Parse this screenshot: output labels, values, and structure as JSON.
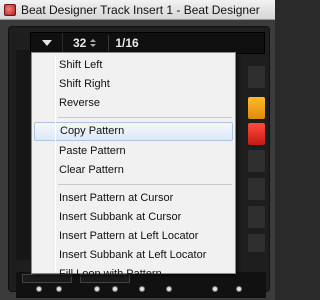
{
  "window": {
    "title": "Beat Designer Track Insert 1 - Beat Designer"
  },
  "toolbar": {
    "pattern_number": "32",
    "step_resolution": "1/16"
  },
  "menu": {
    "groups": [
      [
        "Shift Left",
        "Shift Right",
        "Reverse"
      ],
      [
        "Copy Pattern",
        "Paste Pattern",
        "Clear Pattern"
      ],
      [
        "Insert Pattern at Cursor",
        "Insert Subbank at Cursor",
        "Insert Pattern at Left Locator",
        "Insert Subbank at Left Locator",
        "Fill Loop with Pattern"
      ]
    ],
    "highlighted": "Copy Pattern"
  },
  "colors": {
    "pad_orange": "#f5a623",
    "pad_red": "#e0281e",
    "menu_highlight": "#dde9f8"
  }
}
